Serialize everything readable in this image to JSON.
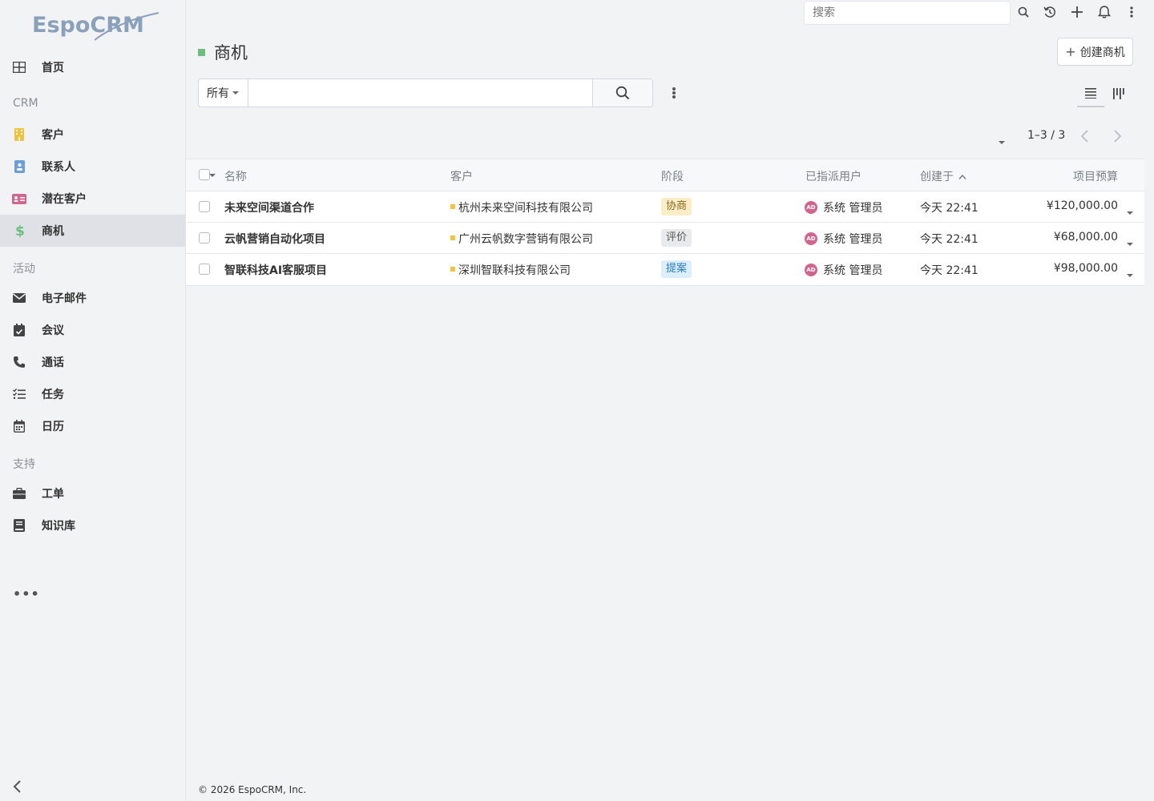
{
  "app": {
    "logo_text": "EspoCRM"
  },
  "topbar": {
    "search_placeholder": "搜索"
  },
  "sidebar": {
    "items": [
      {
        "label": "首页",
        "icon": "grid-icon"
      },
      {
        "label": "客户",
        "icon": "building-icon",
        "color": "#f0c23d"
      },
      {
        "label": "联系人",
        "icon": "contact-card-icon",
        "color": "#6a9fd8"
      },
      {
        "label": "潜在客户",
        "icon": "id-card-icon",
        "color": "#d2648d"
      },
      {
        "label": "商机",
        "icon": "dollar-icon",
        "color": "#6ac07a"
      },
      {
        "label": "电子邮件",
        "icon": "envelope-icon"
      },
      {
        "label": "会议",
        "icon": "calendar-check-icon"
      },
      {
        "label": "通话",
        "icon": "phone-icon"
      },
      {
        "label": "任务",
        "icon": "task-list-icon"
      },
      {
        "label": "日历",
        "icon": "calendar-icon"
      },
      {
        "label": "工单",
        "icon": "briefcase-icon"
      },
      {
        "label": "知识库",
        "icon": "book-icon"
      }
    ],
    "sections": [
      "CRM",
      "活动",
      "支持"
    ],
    "more": "•••"
  },
  "header": {
    "title": "商机",
    "create_label": "创建商机",
    "accent": "#6ac07a"
  },
  "filter": {
    "scope": "所有",
    "search_value": ""
  },
  "pagination": {
    "text": "1–3 / 3"
  },
  "table": {
    "columns": {
      "name": "名称",
      "account": "客户",
      "stage": "阶段",
      "assigned": "已指派用户",
      "created": "创建于",
      "budget": "项目预算"
    },
    "rows": [
      {
        "name": "未来空间渠道合作",
        "account": "杭州未来空间科技有限公司",
        "stage": "协商",
        "stage_bg": "#fbeec7",
        "stage_color": "#8a6a1c",
        "assigned_initials": "AD",
        "assigned": "系统 管理员",
        "created": "今天 22:41",
        "budget": "¥120,000.00"
      },
      {
        "name": "云帆营销自动化项目",
        "account": "广州云帆数字营销有限公司",
        "stage": "评价",
        "stage_bg": "#e9eaec",
        "stage_color": "#555555",
        "assigned_initials": "AD",
        "assigned": "系统 管理员",
        "created": "今天 22:41",
        "budget": "¥68,000.00"
      },
      {
        "name": "智联科技AI客服项目",
        "account": "深圳智联科技有限公司",
        "stage": "提案",
        "stage_bg": "#dbeefb",
        "stage_color": "#2a7cc0",
        "assigned_initials": "AD",
        "assigned": "系统 管理员",
        "created": "今天 22:41",
        "budget": "¥98,000.00"
      }
    ]
  },
  "footer": {
    "text": "© 2026 EspoCRM, Inc."
  }
}
